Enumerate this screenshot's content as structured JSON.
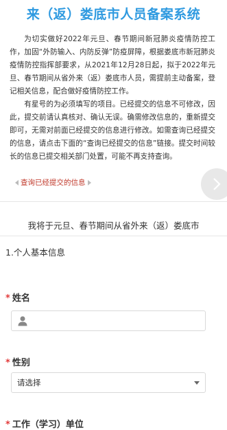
{
  "header": {
    "title": "来（返）娄底市人员备案系统"
  },
  "notice": {
    "paragraph1": "为切实做好2022年元旦、春节期间新冠肺炎疫情防控工作，加固“外防输入、内防反弹”防疫屏障，根据娄底市新冠肺炎疫情防控指挥部要求，从2021年12月28日起，拟于2022年元旦、春节期间从省外来（返）娄底市人员，需提前主动备案，登记相关信息，配合做好疫情防控工作。",
    "paragraph2": "有星号的为必须填写的项目。已经提交的信息不可修改，因此，提交前请认真核对、确认无误。确需修改信息的，重新提交即可，无需对前面已经提交的信息进行修改。如需查询已经提交的信息，请点击下面的“查询已经提交的信息”链接。提交时间较长的信息已提交相关部门处置，可能不再支持查询。"
  },
  "query_link": {
    "label": "查询已经提交的信息"
  },
  "statement": "我将于元旦、春节期间从省外来（返）娄底市",
  "section": {
    "title": "1.个人基本信息"
  },
  "fields": {
    "name": {
      "required_mark": "*",
      "label": "姓名"
    },
    "gender": {
      "required_mark": "*",
      "label": "性别",
      "selected": "请选择"
    },
    "work": {
      "required_mark": "*",
      "label": "工作（学习）单位"
    }
  },
  "colors": {
    "title": "#2f9ae0",
    "link": "#c0392b",
    "required": "#e23b3b"
  },
  "icons": {
    "next": "chevron-right-icon",
    "user": "user-icon",
    "dropdown": "caret-down-icon"
  }
}
